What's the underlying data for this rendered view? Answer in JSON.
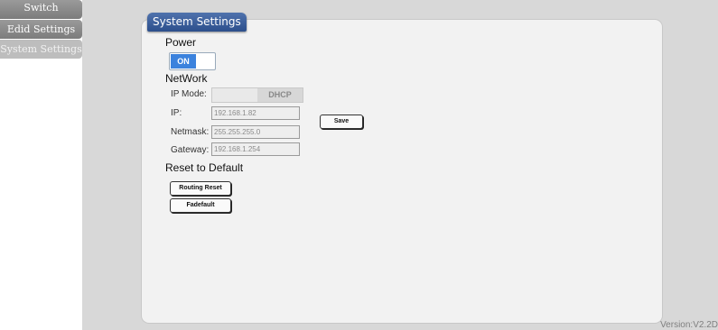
{
  "nav": {
    "items": [
      {
        "label": "Switch"
      },
      {
        "label": "Edid Settings"
      },
      {
        "label": "System Settings"
      }
    ]
  },
  "panel": {
    "title": "System Settings",
    "power": {
      "heading": "Power",
      "toggle_label": "ON"
    },
    "network": {
      "heading": "NetWork",
      "ip_mode_label": "IP Mode:",
      "ip_mode_value": "DHCP",
      "ip_label": "IP:",
      "ip_value": "192.168.1.82",
      "netmask_label": "Netmask:",
      "netmask_value": "255.255.255.0",
      "gateway_label": "Gateway:",
      "gateway_value": "192.168.1.254",
      "save_label": "Save"
    },
    "reset": {
      "heading": "Reset to Default",
      "routing_reset_label": "Routing Reset",
      "fadefault_label": "Fadefault"
    }
  },
  "footer": {
    "version": "Version:V2.2D"
  }
}
